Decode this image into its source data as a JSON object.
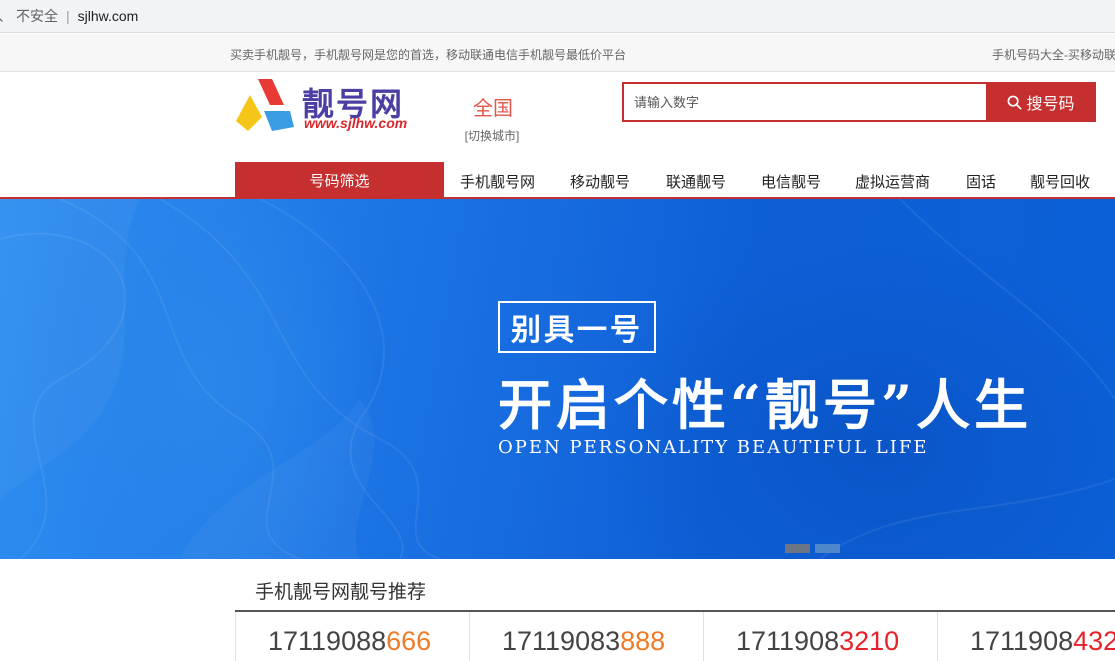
{
  "browser": {
    "lead": "、",
    "insecure_label": "不安全",
    "separator": "|",
    "url": "sjlhw.com"
  },
  "top_strip": {
    "slogan": "买卖手机靓号，手机靓号网是您的首选，移动联通电信手机靓号最低价平台",
    "right_text": "手机号码大全-买移动联"
  },
  "header": {
    "brand": "靓号网",
    "domain": "www.sjlhw.com",
    "city": "全国",
    "switch_city": "[切换城市]",
    "search": {
      "placeholder": "请输入数字",
      "button_label": "搜号码"
    }
  },
  "nav": {
    "filter_label": "号码筛选",
    "items": [
      "手机靓号网",
      "移动靓号",
      "联通靓号",
      "电信靓号",
      "虚拟运营商",
      "固话",
      "靓号回收"
    ]
  },
  "banner": {
    "tag": "别具一号",
    "headline": "开启个性“靓号”人生",
    "subline": "OPEN PERSONALITY BEAUTIFUL LIFE"
  },
  "recommend": {
    "title": "手机靓号网靓号推荐",
    "numbers": [
      {
        "prefix": "17119088",
        "suffix": "666",
        "suffix_color": "#f07b26"
      },
      {
        "prefix": "17119083",
        "suffix": "888",
        "suffix_color": "#f07b26"
      },
      {
        "prefix": "1711908",
        "suffix": "3210",
        "suffix_color": "#e8222a"
      },
      {
        "prefix": "1711908",
        "suffix": "432",
        "suffix_color": "#e8222a"
      }
    ]
  },
  "colors": {
    "brand_red": "#c62f2f",
    "brand_purple": "#4a3fa3",
    "banner_blue": "#0e5fd6"
  },
  "icons": {
    "search_button": "search-icon"
  }
}
